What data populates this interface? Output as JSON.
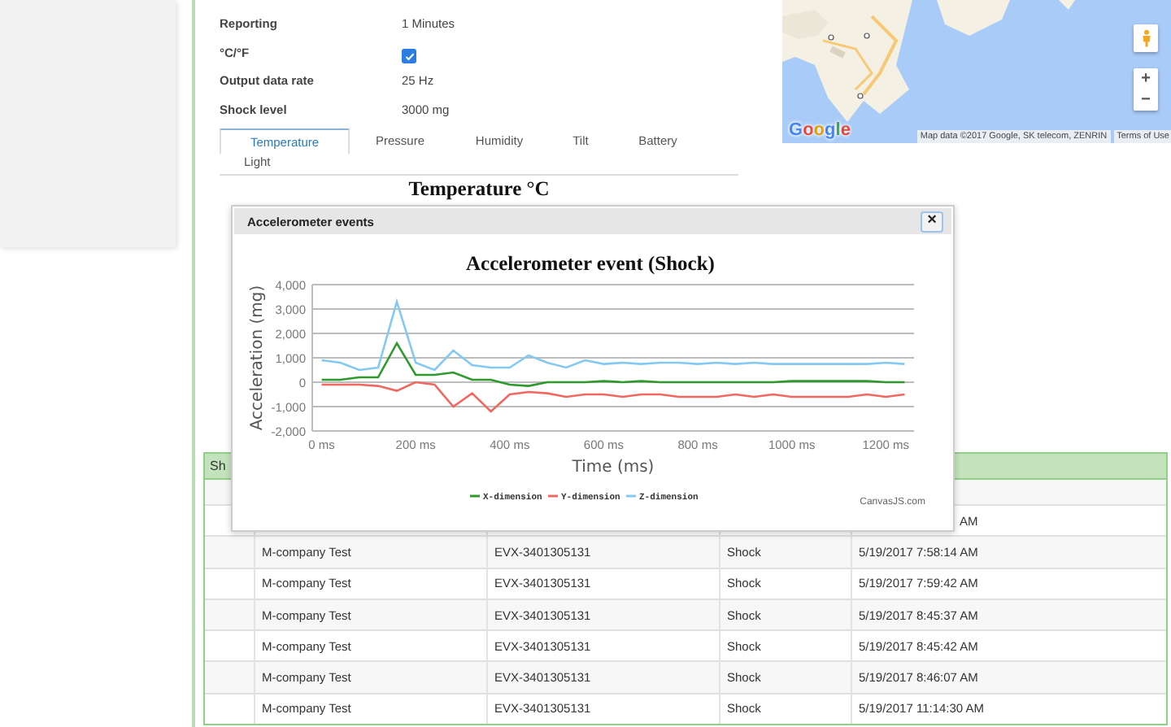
{
  "settings": [
    {
      "label": "Reporting",
      "kind": "text",
      "value": "1 Minutes"
    },
    {
      "label": "°C/°F",
      "kind": "checkbox",
      "checked": true
    },
    {
      "label": "Output data rate",
      "kind": "text",
      "value": "25 Hz"
    },
    {
      "label": "Shock level",
      "kind": "text",
      "value": "3000 mg"
    }
  ],
  "tabs": [
    {
      "label": "Temperature",
      "selected": true
    },
    {
      "label": "Pressure",
      "selected": false
    },
    {
      "label": "Humidity",
      "selected": false
    },
    {
      "label": "Tilt",
      "selected": false
    },
    {
      "label": "Battery",
      "selected": false
    },
    {
      "label": "Light",
      "selected": false
    }
  ],
  "chart_title": "Temperature  °C",
  "map": {
    "logo": "Google",
    "attribution": "Map data ©2017 Google, SK telecom, ZENRIN",
    "terms": "Terms of Use",
    "zoom_in": "+",
    "zoom_out": "−"
  },
  "table": {
    "title": "Sh",
    "rows": [
      {
        "kind": "partial",
        "company": "",
        "device": "",
        "event": "",
        "time": "AM"
      },
      {
        "kind": "full",
        "company": "M-company Test",
        "device": "EVX-3401305131",
        "event": "Shock",
        "time": "5/19/2017 7:58:14 AM"
      },
      {
        "kind": "full",
        "company": "M-company Test",
        "device": "EVX-3401305131",
        "event": "Shock",
        "time": "5/19/2017 7:59:42 AM"
      },
      {
        "kind": "full",
        "company": "M-company Test",
        "device": "EVX-3401305131",
        "event": "Shock",
        "time": "5/19/2017 8:45:37 AM"
      },
      {
        "kind": "full",
        "company": "M-company Test",
        "device": "EVX-3401305131",
        "event": "Shock",
        "time": "5/19/2017 8:45:42 AM"
      },
      {
        "kind": "full",
        "company": "M-company Test",
        "device": "EVX-3401305131",
        "event": "Shock",
        "time": "5/19/2017 8:46:07 AM"
      },
      {
        "kind": "full",
        "company": "M-company Test",
        "device": "EVX-3401305131",
        "event": "Shock",
        "time": "5/19/2017 11:14:30 AM"
      }
    ]
  },
  "dialog": {
    "title": "Accelerometer events",
    "close": "×",
    "credit": "CanvasJS.com",
    "chart_data": {
      "type": "line",
      "title": "Accelerometer event (Shock)",
      "xlabel": "Time (ms)",
      "ylabel": "Acceleration (mg)",
      "x": [
        0,
        40,
        80,
        120,
        160,
        200,
        240,
        280,
        320,
        360,
        400,
        440,
        480,
        520,
        560,
        600,
        640,
        680,
        720,
        760,
        800,
        840,
        880,
        920,
        960,
        1000,
        1040,
        1080,
        1120,
        1160,
        1200,
        1240
      ],
      "series": [
        {
          "name": "X-dimension",
          "color": "#2e9a2e",
          "values": [
            100,
            100,
            200,
            200,
            1600,
            300,
            300,
            400,
            100,
            100,
            -100,
            -150,
            0,
            0,
            0,
            50,
            0,
            50,
            0,
            0,
            0,
            0,
            0,
            0,
            0,
            50,
            50,
            50,
            50,
            50,
            0,
            0
          ]
        },
        {
          "name": "Y-dimension",
          "color": "#f0685f",
          "values": [
            -100,
            -100,
            -100,
            -150,
            -350,
            0,
            -100,
            -1000,
            -450,
            -1200,
            -500,
            -400,
            -450,
            -600,
            -500,
            -500,
            -600,
            -500,
            -500,
            -600,
            -600,
            -600,
            -500,
            -600,
            -500,
            -600,
            -600,
            -600,
            -600,
            -500,
            -600,
            -500
          ]
        },
        {
          "name": "Z-dimension",
          "color": "#84c9f2",
          "values": [
            900,
            800,
            500,
            600,
            3300,
            800,
            500,
            1300,
            700,
            600,
            600,
            1100,
            800,
            600,
            900,
            750,
            800,
            750,
            800,
            800,
            750,
            800,
            750,
            800,
            750,
            750,
            750,
            750,
            750,
            750,
            800,
            750
          ]
        }
      ],
      "grid": true,
      "legend": true,
      "xlim": [
        -20,
        1260
      ],
      "ylim": [
        -2000,
        4000
      ],
      "xticks": [
        {
          "value": 0,
          "label": "0 ms"
        },
        {
          "value": 200,
          "label": "200 ms"
        },
        {
          "value": 400,
          "label": "400 ms"
        },
        {
          "value": 600,
          "label": "600 ms"
        },
        {
          "value": 800,
          "label": "800 ms"
        },
        {
          "value": 1000,
          "label": "1000 ms"
        },
        {
          "value": 1200,
          "label": "1200 ms"
        }
      ],
      "yticks": [
        {
          "value": 4000,
          "label": "4,000"
        },
        {
          "value": 3000,
          "label": "3,000"
        },
        {
          "value": 2000,
          "label": "2,000"
        },
        {
          "value": 1000,
          "label": "1,000"
        },
        {
          "value": 0,
          "label": "0"
        },
        {
          "value": -1000,
          "label": "-1,000"
        },
        {
          "value": -2000,
          "label": "-2,000"
        }
      ]
    }
  }
}
